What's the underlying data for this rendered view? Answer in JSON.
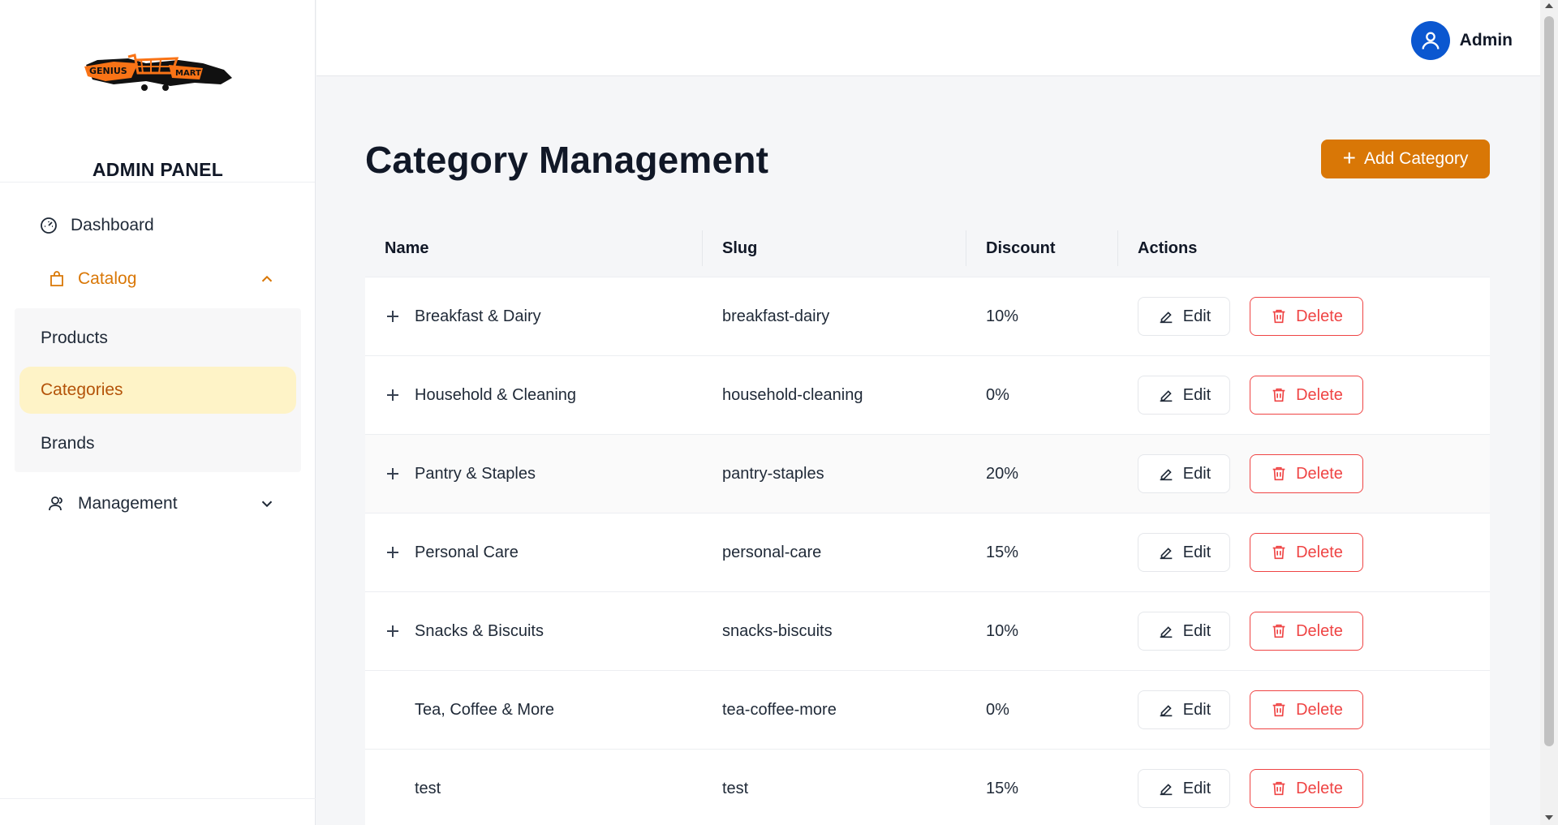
{
  "sidebar": {
    "brand_primary": "GENIUS",
    "brand_secondary": "MART",
    "title": "ADMIN PANEL",
    "nav": {
      "dashboard": "Dashboard",
      "catalog": "Catalog",
      "management": "Management"
    },
    "catalog_items": [
      "Products",
      "Categories",
      "Brands"
    ],
    "active_item": "Categories"
  },
  "topbar": {
    "user_name": "Admin"
  },
  "main": {
    "title": "Category Management",
    "add_button": "Add Category",
    "columns": [
      "Name",
      "Slug",
      "Discount",
      "Actions"
    ],
    "edit_label": "Edit",
    "delete_label": "Delete",
    "rows": [
      {
        "name": "Breakfast & Dairy",
        "slug": "breakfast-dairy",
        "discount": "10%",
        "expandable": true
      },
      {
        "name": "Household & Cleaning",
        "slug": "household-cleaning",
        "discount": "0%",
        "expandable": true
      },
      {
        "name": "Pantry & Staples",
        "slug": "pantry-staples",
        "discount": "20%",
        "expandable": true
      },
      {
        "name": "Personal Care",
        "slug": "personal-care",
        "discount": "15%",
        "expandable": true
      },
      {
        "name": "Snacks & Biscuits",
        "slug": "snacks-biscuits",
        "discount": "10%",
        "expandable": true
      },
      {
        "name": "Tea, Coffee & More",
        "slug": "tea-coffee-more",
        "discount": "0%",
        "expandable": false
      },
      {
        "name": "test",
        "slug": "test",
        "discount": "15%",
        "expandable": false
      }
    ]
  },
  "colors": {
    "accent": "#d97706",
    "active_bg": "#fef3c7",
    "danger": "#ef4444",
    "avatar": "#0b57d0"
  }
}
